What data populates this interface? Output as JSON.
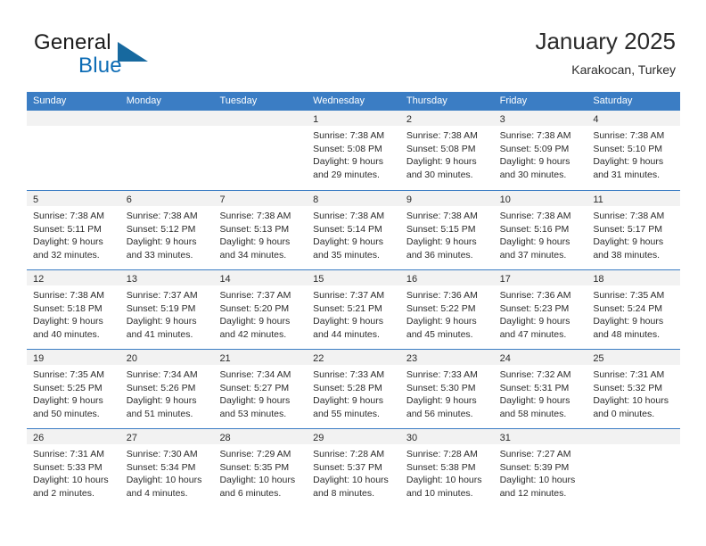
{
  "brand": {
    "word_top": "General",
    "word_bottom": "Blue",
    "color_blue": "#0d6cb5",
    "triangle_color": "#17699f",
    "triangle_icon": "triangle-icon"
  },
  "header": {
    "title": "January 2025",
    "subtitle": "Karakocan, Turkey"
  },
  "theme": {
    "header_row_bg": "#3b7dc4",
    "daynum_bar_bg": "#f2f2f2",
    "text": "#2b2b2b"
  },
  "calendar": {
    "weekday_headers": [
      "Sunday",
      "Monday",
      "Tuesday",
      "Wednesday",
      "Thursday",
      "Friday",
      "Saturday"
    ],
    "weeks": [
      [
        {
          "day": "",
          "lines": []
        },
        {
          "day": "",
          "lines": []
        },
        {
          "day": "",
          "lines": []
        },
        {
          "day": "1",
          "lines": [
            "Sunrise: 7:38 AM",
            "Sunset: 5:08 PM",
            "Daylight: 9 hours",
            "and 29 minutes."
          ]
        },
        {
          "day": "2",
          "lines": [
            "Sunrise: 7:38 AM",
            "Sunset: 5:08 PM",
            "Daylight: 9 hours",
            "and 30 minutes."
          ]
        },
        {
          "day": "3",
          "lines": [
            "Sunrise: 7:38 AM",
            "Sunset: 5:09 PM",
            "Daylight: 9 hours",
            "and 30 minutes."
          ]
        },
        {
          "day": "4",
          "lines": [
            "Sunrise: 7:38 AM",
            "Sunset: 5:10 PM",
            "Daylight: 9 hours",
            "and 31 minutes."
          ]
        }
      ],
      [
        {
          "day": "5",
          "lines": [
            "Sunrise: 7:38 AM",
            "Sunset: 5:11 PM",
            "Daylight: 9 hours",
            "and 32 minutes."
          ]
        },
        {
          "day": "6",
          "lines": [
            "Sunrise: 7:38 AM",
            "Sunset: 5:12 PM",
            "Daylight: 9 hours",
            "and 33 minutes."
          ]
        },
        {
          "day": "7",
          "lines": [
            "Sunrise: 7:38 AM",
            "Sunset: 5:13 PM",
            "Daylight: 9 hours",
            "and 34 minutes."
          ]
        },
        {
          "day": "8",
          "lines": [
            "Sunrise: 7:38 AM",
            "Sunset: 5:14 PM",
            "Daylight: 9 hours",
            "and 35 minutes."
          ]
        },
        {
          "day": "9",
          "lines": [
            "Sunrise: 7:38 AM",
            "Sunset: 5:15 PM",
            "Daylight: 9 hours",
            "and 36 minutes."
          ]
        },
        {
          "day": "10",
          "lines": [
            "Sunrise: 7:38 AM",
            "Sunset: 5:16 PM",
            "Daylight: 9 hours",
            "and 37 minutes."
          ]
        },
        {
          "day": "11",
          "lines": [
            "Sunrise: 7:38 AM",
            "Sunset: 5:17 PM",
            "Daylight: 9 hours",
            "and 38 minutes."
          ]
        }
      ],
      [
        {
          "day": "12",
          "lines": [
            "Sunrise: 7:38 AM",
            "Sunset: 5:18 PM",
            "Daylight: 9 hours",
            "and 40 minutes."
          ]
        },
        {
          "day": "13",
          "lines": [
            "Sunrise: 7:37 AM",
            "Sunset: 5:19 PM",
            "Daylight: 9 hours",
            "and 41 minutes."
          ]
        },
        {
          "day": "14",
          "lines": [
            "Sunrise: 7:37 AM",
            "Sunset: 5:20 PM",
            "Daylight: 9 hours",
            "and 42 minutes."
          ]
        },
        {
          "day": "15",
          "lines": [
            "Sunrise: 7:37 AM",
            "Sunset: 5:21 PM",
            "Daylight: 9 hours",
            "and 44 minutes."
          ]
        },
        {
          "day": "16",
          "lines": [
            "Sunrise: 7:36 AM",
            "Sunset: 5:22 PM",
            "Daylight: 9 hours",
            "and 45 minutes."
          ]
        },
        {
          "day": "17",
          "lines": [
            "Sunrise: 7:36 AM",
            "Sunset: 5:23 PM",
            "Daylight: 9 hours",
            "and 47 minutes."
          ]
        },
        {
          "day": "18",
          "lines": [
            "Sunrise: 7:35 AM",
            "Sunset: 5:24 PM",
            "Daylight: 9 hours",
            "and 48 minutes."
          ]
        }
      ],
      [
        {
          "day": "19",
          "lines": [
            "Sunrise: 7:35 AM",
            "Sunset: 5:25 PM",
            "Daylight: 9 hours",
            "and 50 minutes."
          ]
        },
        {
          "day": "20",
          "lines": [
            "Sunrise: 7:34 AM",
            "Sunset: 5:26 PM",
            "Daylight: 9 hours",
            "and 51 minutes."
          ]
        },
        {
          "day": "21",
          "lines": [
            "Sunrise: 7:34 AM",
            "Sunset: 5:27 PM",
            "Daylight: 9 hours",
            "and 53 minutes."
          ]
        },
        {
          "day": "22",
          "lines": [
            "Sunrise: 7:33 AM",
            "Sunset: 5:28 PM",
            "Daylight: 9 hours",
            "and 55 minutes."
          ]
        },
        {
          "day": "23",
          "lines": [
            "Sunrise: 7:33 AM",
            "Sunset: 5:30 PM",
            "Daylight: 9 hours",
            "and 56 minutes."
          ]
        },
        {
          "day": "24",
          "lines": [
            "Sunrise: 7:32 AM",
            "Sunset: 5:31 PM",
            "Daylight: 9 hours",
            "and 58 minutes."
          ]
        },
        {
          "day": "25",
          "lines": [
            "Sunrise: 7:31 AM",
            "Sunset: 5:32 PM",
            "Daylight: 10 hours",
            "and 0 minutes."
          ]
        }
      ],
      [
        {
          "day": "26",
          "lines": [
            "Sunrise: 7:31 AM",
            "Sunset: 5:33 PM",
            "Daylight: 10 hours",
            "and 2 minutes."
          ]
        },
        {
          "day": "27",
          "lines": [
            "Sunrise: 7:30 AM",
            "Sunset: 5:34 PM",
            "Daylight: 10 hours",
            "and 4 minutes."
          ]
        },
        {
          "day": "28",
          "lines": [
            "Sunrise: 7:29 AM",
            "Sunset: 5:35 PM",
            "Daylight: 10 hours",
            "and 6 minutes."
          ]
        },
        {
          "day": "29",
          "lines": [
            "Sunrise: 7:28 AM",
            "Sunset: 5:37 PM",
            "Daylight: 10 hours",
            "and 8 minutes."
          ]
        },
        {
          "day": "30",
          "lines": [
            "Sunrise: 7:28 AM",
            "Sunset: 5:38 PM",
            "Daylight: 10 hours",
            "and 10 minutes."
          ]
        },
        {
          "day": "31",
          "lines": [
            "Sunrise: 7:27 AM",
            "Sunset: 5:39 PM",
            "Daylight: 10 hours",
            "and 12 minutes."
          ]
        },
        {
          "day": "",
          "lines": []
        }
      ]
    ]
  }
}
